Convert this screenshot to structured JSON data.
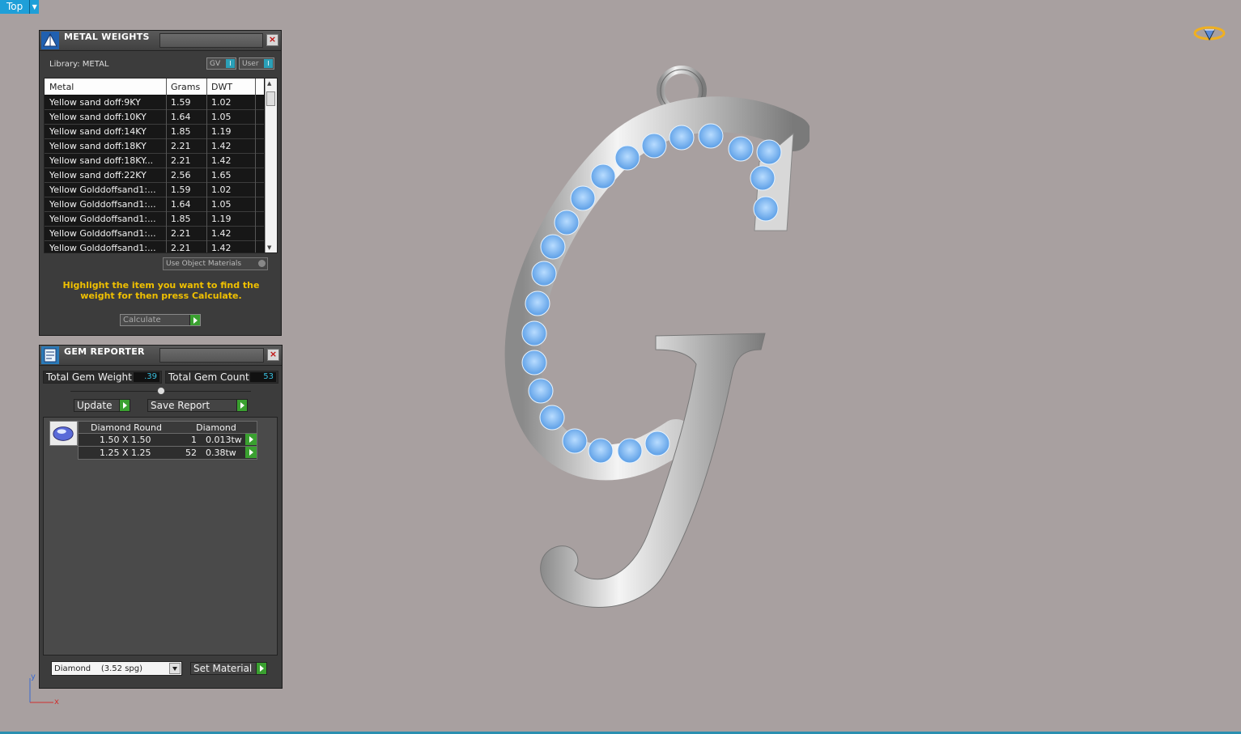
{
  "viewport": {
    "label": "Top"
  },
  "axes": {
    "y_label": "y",
    "x_label": "x"
  },
  "metal_weights": {
    "title": "METAL WEIGHTS",
    "library": "Library: METAL",
    "toggle_gv": "GV",
    "toggle_user": "User",
    "columns": [
      "Metal",
      "Grams",
      "DWT"
    ],
    "rows": [
      [
        "Yellow sand doff:9KY",
        "1.59",
        "1.02"
      ],
      [
        "Yellow sand doff:10KY",
        "1.64",
        "1.05"
      ],
      [
        "Yellow sand doff:14KY",
        "1.85",
        "1.19"
      ],
      [
        "Yellow sand doff:18KY",
        "2.21",
        "1.42"
      ],
      [
        "Yellow sand doff:18KY...",
        "2.21",
        "1.42"
      ],
      [
        "Yellow sand doff:22KY",
        "2.56",
        "1.65"
      ],
      [
        "Yellow Golddoffsand1:...",
        "1.59",
        "1.02"
      ],
      [
        "Yellow Golddoffsand1:...",
        "1.64",
        "1.05"
      ],
      [
        "Yellow Golddoffsand1:...",
        "1.85",
        "1.19"
      ],
      [
        "Yellow Golddoffsand1:...",
        "2.21",
        "1.42"
      ],
      [
        "Yellow Golddoffsand1:...",
        "2.21",
        "1.42"
      ]
    ],
    "use_object_materials": "Use Object Materials",
    "hint": "Highlight the item you want to find the weight for then press Calculate.",
    "calculate": "Calculate"
  },
  "gem_reporter": {
    "title": "GEM REPORTER",
    "total_weight_label": "Total Gem Weight",
    "total_weight_value": ".39",
    "total_count_label": "Total Gem Count",
    "total_count_value": "53",
    "update": "Update",
    "save_report": "Save Report",
    "table_headers": [
      "Diamond Round",
      "Diamond"
    ],
    "rows": [
      {
        "size": "1.50 X 1.50",
        "count": "1",
        "weight": "0.013tw"
      },
      {
        "size": "1.25 X 1.25",
        "count": "52",
        "weight": "0.38tw"
      }
    ],
    "material_select": "Diamond    (3.52 spg)",
    "set_material": "Set Material"
  },
  "colors": {
    "background": "#a8a0a0",
    "panel": "#3c3c3c",
    "accent": "#1e9fd8",
    "hint": "#f0c000",
    "gem": "#7ab6ee",
    "metal": "#d4d4d4"
  },
  "icons": [
    "chevron-down-icon",
    "ring-icon",
    "pyramid-icon",
    "report-icon",
    "close-icon",
    "play-icon",
    "gem-thumbnail-icon"
  ]
}
